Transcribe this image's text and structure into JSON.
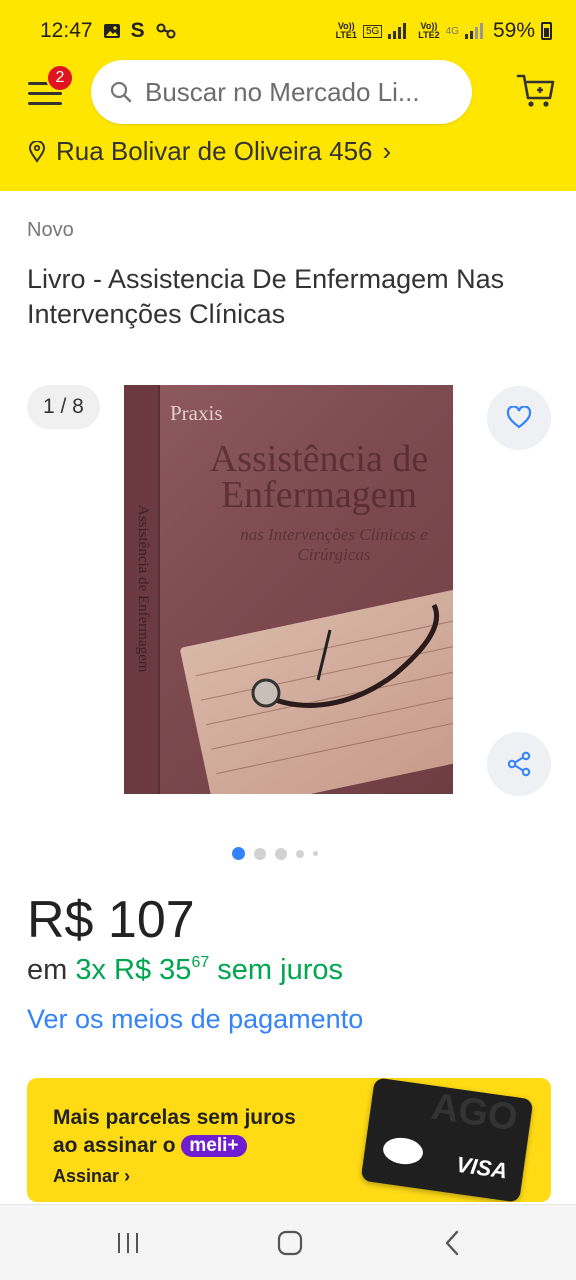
{
  "status_bar": {
    "time": "12:47",
    "sim1_label_top": "Vo))",
    "sim1_label_bottom": "LTE1",
    "sim1_network": "5G",
    "sim2_label_top": "Vo))",
    "sim2_label_bottom": "LTE2",
    "sim2_network": "4G",
    "battery": "59%"
  },
  "header": {
    "menu_badge": "2",
    "search_placeholder": "Buscar no Mercado Li...",
    "location": "Rua Bolivar de Oliveira 456",
    "location_chevron": "›"
  },
  "product": {
    "condition": "Novo",
    "title": "Livro - Assistencia De Enfermagem Nas Intervenções Clínicas",
    "gallery_counter": "1 / 8",
    "gallery_pages": 8,
    "gallery_current": 1,
    "cover": {
      "publisher": "Praxis",
      "title": "Assistência de Enfermagem",
      "subtitle": "nas Intervenções Clínicas e Cirúrgicas",
      "spine": "Assistência de Enfermagem"
    }
  },
  "pricing": {
    "price": "R$ 107",
    "installment_prefix": "em",
    "installment_main": "3x R$ 35",
    "installment_cents": "67",
    "installment_suffix": "sem juros",
    "payment_link": "Ver os meios de pagamento"
  },
  "promo": {
    "line1": "Mais parcelas sem juros",
    "line2": "ao assinar o",
    "brand": "meli+",
    "cta": "Assinar",
    "cta_chevron": "›",
    "card_brand": "VISA",
    "card_watermark": "AGO"
  },
  "colors": {
    "header_yellow": "#ffe600",
    "link_blue": "#3483fa",
    "installment_green": "#00a650",
    "badge_red": "#e0141e",
    "meli_purple": "#6e1ecf"
  },
  "icons": {
    "menu": "hamburger-icon",
    "search": "search-icon",
    "cart": "cart-icon",
    "location": "location-pin-icon",
    "favorite": "heart-icon",
    "share": "share-icon"
  }
}
